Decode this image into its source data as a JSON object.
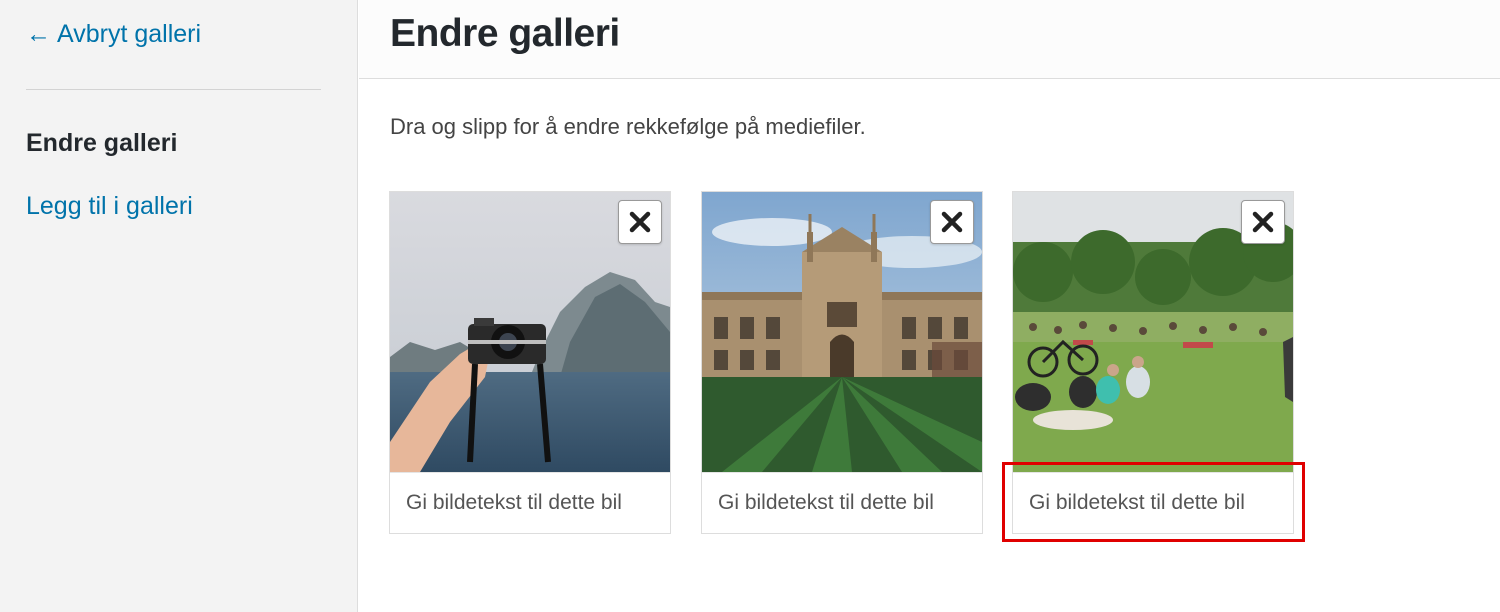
{
  "sidebar": {
    "cancel_arrow": "←",
    "cancel_label": "Avbryt galleri",
    "items": [
      {
        "label": "Endre galleri"
      },
      {
        "label": "Legg til i galleri"
      }
    ]
  },
  "header": {
    "title": "Endre galleri"
  },
  "main": {
    "instruction": "Dra og slipp for å endre rekkefølge på mediefiler.",
    "gallery": [
      {
        "image": "lake-mountain-camera-photo",
        "caption_placeholder": "Gi bildetekst til dette bil"
      },
      {
        "image": "college-building-lawn-photo",
        "caption_placeholder": "Gi bildetekst til dette bil"
      },
      {
        "image": "park-picnic-crowd-photo",
        "caption_placeholder": "Gi bildetekst til dette bil"
      }
    ]
  },
  "colors": {
    "link": "#0073aa",
    "highlight": "#e00000"
  },
  "icons": {
    "remove": "close-icon"
  }
}
